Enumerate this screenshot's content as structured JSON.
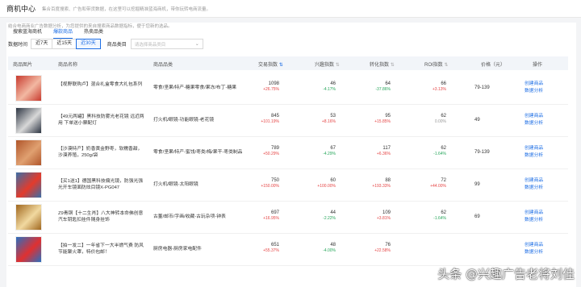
{
  "header": {
    "title": "商机中心",
    "desc": "集合百度搜索、广告和带货数据，在这里可以挖掘精准蓝海商机，带你玩转电商流量。"
  },
  "tabs": [
    {
      "label": "搜索蓝海商机",
      "active": false
    },
    {
      "label": "爆款商品",
      "active": true
    },
    {
      "label": "热卖品类",
      "active": false
    }
  ],
  "hint": "结合电商商业广告数据分析，为您提供的来自搜索商品数据指标，便于您新的选品。",
  "filters": {
    "time_label": "数据时间",
    "time_options": [
      {
        "label": "近7天",
        "active": false
      },
      {
        "label": "近15天",
        "active": false
      },
      {
        "label": "近30天",
        "active": true
      }
    ],
    "category_label": "商品类目",
    "category_placeholder": "请选择商品类目"
  },
  "table": {
    "columns": [
      "商品图片",
      "商品名称",
      "商品品类",
      "交易指数",
      "兴趣指数",
      "转化指数",
      "ROI指数",
      "价格（元）",
      "操作"
    ],
    "rows": [
      {
        "name": "【视野联购卢】混合礼盒零食大礼包系列",
        "category": "零食/坚果/特产-糖果零食/果冻/布丁-糖果",
        "trade": "1098",
        "trade_chg": "+26.75%",
        "trade_dir": "up",
        "interest": "46",
        "interest_chg": "-4.17%",
        "interest_dir": "down",
        "conv": "64",
        "conv_chg": "-37.86%",
        "conv_dir": "down",
        "roi": "66",
        "roi_chg": "+3.13%",
        "roi_dir": "up",
        "price": "79-139",
        "img_colors": [
          "#c83a2e",
          "#f2b8a2"
        ]
      },
      {
        "name": "【49元两罐】黑科技防雾光老花镜 远近两用 下单送小票配灯",
        "category": "打火机/眼镜-功能眼镜-老花镜",
        "trade": "845",
        "trade_chg": "+101.19%",
        "trade_dir": "up",
        "interest": "53",
        "interest_chg": "+8.16%",
        "interest_dir": "up",
        "conv": "95",
        "conv_chg": "+15.85%",
        "conv_dir": "up",
        "roi": "62",
        "roi_chg": "0.00%",
        "roi_dir": "flat",
        "price": "49",
        "img_colors": [
          "#2c3442",
          "#d8d8d8"
        ]
      },
      {
        "name": "【沙漠特产】奶香黄金野枣，软糯香甜，沙漠养殖，250g/袋",
        "category": "零食/坚果/特产-蜜饯/枣类/梅/果干-枣类制品",
        "trade": "789",
        "trade_chg": "+50.29%",
        "trade_dir": "up",
        "interest": "67",
        "interest_chg": "-4.29%",
        "interest_dir": "down",
        "conv": "117",
        "conv_chg": "+6.36%",
        "conv_dir": "up",
        "roi": "62",
        "roi_chg": "-1.64%",
        "roi_dir": "down",
        "price": "79-139",
        "img_colors": [
          "#b0552a",
          "#e0a070"
        ]
      },
      {
        "name": "【买1送1】德国黑科技偏光镜，防强光强光开车镜面防炫目镜X-PG047",
        "category": "打火机/眼镜-太阳眼镜",
        "trade": "750",
        "trade_chg": "+150.00%",
        "trade_dir": "up",
        "interest": "60",
        "interest_chg": "+100.00%",
        "interest_dir": "up",
        "conv": "88",
        "conv_chg": "+193.33%",
        "conv_dir": "up",
        "roi": "72",
        "roi_chg": "+44.00%",
        "roi_dir": "up",
        "price": "99",
        "img_colors": [
          "#3a6ea8",
          "#e33b2b"
        ]
      },
      {
        "name": "Z9青铜【十二生肖】八大神转本命佛创意汽车钥匙扣挂件随身挂饰",
        "category": "古董/邮币/字画/收藏-古玩杂项-钟表",
        "trade": "697",
        "trade_chg": "+16.95%",
        "trade_dir": "up",
        "interest": "44",
        "interest_chg": "-2.22%",
        "interest_dir": "down",
        "conv": "109",
        "conv_chg": "+3.81%",
        "conv_dir": "up",
        "roi": "62",
        "roi_chg": "-1.64%",
        "roi_dir": "down",
        "price": "69",
        "img_colors": [
          "#a0671e",
          "#f1d9a0"
        ]
      },
      {
        "name": "【拍一发二】一年省下一大半燃气费 防风节能聚火罩，特价包邮！",
        "category": "厨房电器-厨房家电配件",
        "trade": "651",
        "trade_chg": "+55.37%",
        "trade_dir": "up",
        "interest": "48",
        "interest_chg": "-4.00%",
        "interest_dir": "down",
        "conv": "76",
        "conv_chg": "+22.58%",
        "conv_dir": "up",
        "roi": "",
        "roi_chg": "",
        "roi_dir": "flat",
        "price": "",
        "img_colors": [
          "#2a6fc0",
          "#e03030"
        ]
      }
    ],
    "action_create": "创建商品",
    "action_analyze": "数据分析"
  },
  "watermark": "头条 @兴趣广告老将刘佳",
  "colors": {
    "accent": "#1f6fe5",
    "up": "#e54545",
    "down": "#26a65b"
  }
}
